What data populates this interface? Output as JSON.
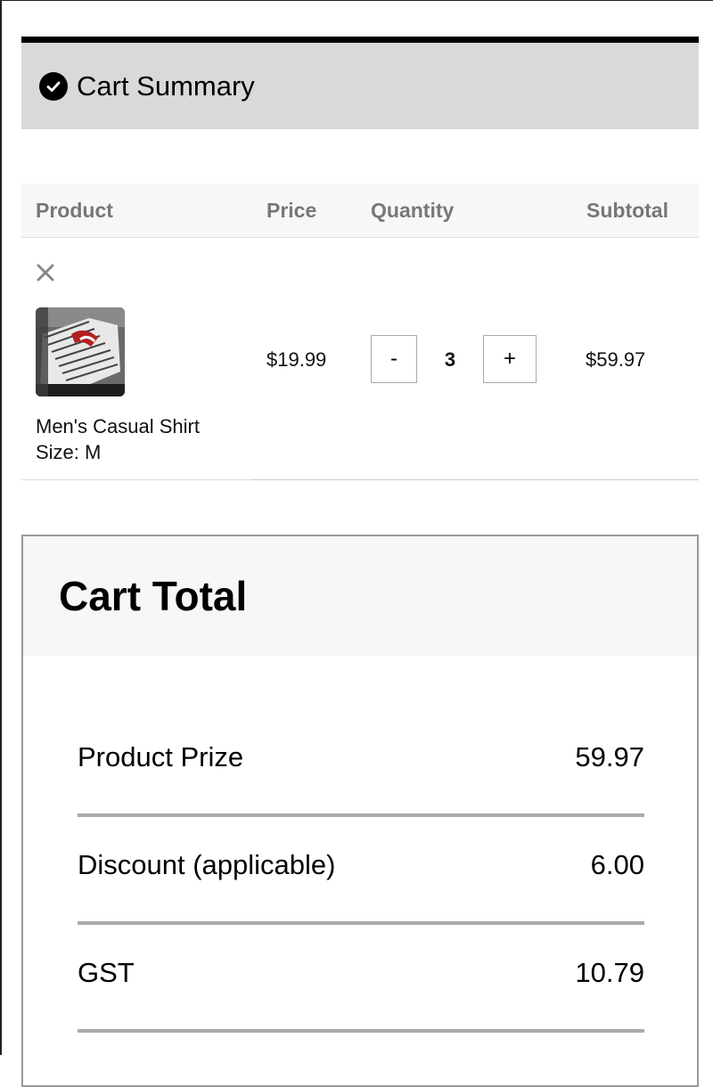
{
  "summary": {
    "title": "Cart Summary",
    "icon": "check-circle-icon"
  },
  "table": {
    "headers": [
      "Product",
      "Price",
      "Quantity",
      "Subtotal"
    ],
    "items": [
      {
        "name": "Men's Casual Shirt",
        "size": "Size: M",
        "price": "$19.99",
        "quantity": "3",
        "minus_label": "-",
        "plus_label": "+",
        "subtotal": "$59.97"
      }
    ]
  },
  "totals": {
    "title": "Cart Total",
    "rows": [
      {
        "label": "Product Prize",
        "value": "59.97"
      },
      {
        "label": "Discount (applicable)",
        "value": "6.00"
      },
      {
        "label": "GST",
        "value": "10.79"
      }
    ]
  }
}
